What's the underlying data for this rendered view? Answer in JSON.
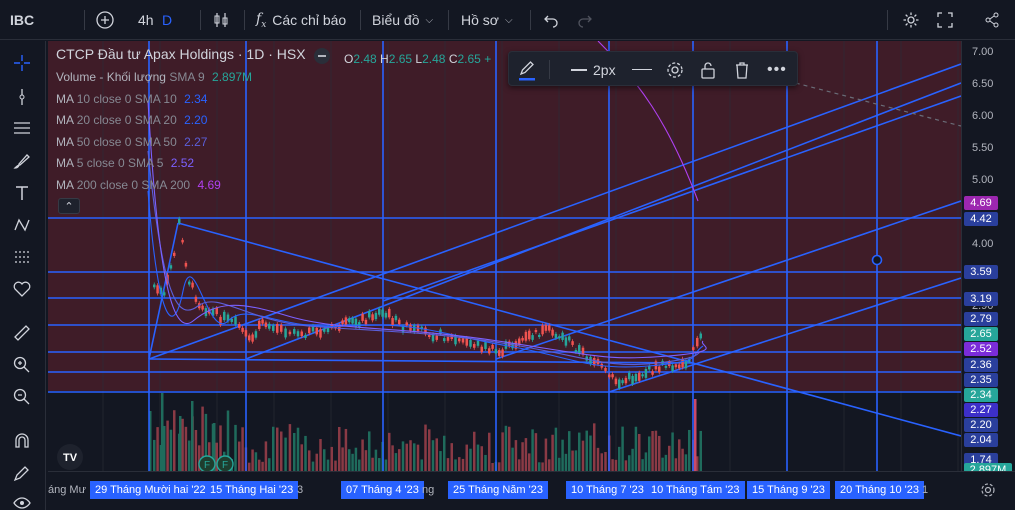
{
  "toolbar": {
    "symbol": "IBC",
    "interval": "4h",
    "interval_d": "D",
    "indicators": "Các chỉ báo",
    "chart_type": "Biểu đồ",
    "profile": "Hồ sơ"
  },
  "legend": {
    "title": "CTCP Đầu tư Apax Holdings · 1D · HSX",
    "ohlc": {
      "o_label": "O",
      "o": "2.48",
      "h_label": "H",
      "h": "2.65",
      "l_label": "L",
      "l": "2.48",
      "c_label": "C",
      "c": "2.65",
      "plus": "+"
    },
    "rows": [
      {
        "label": "Volume - Khối lượng",
        "params": "SMA 9",
        "value": "2.897M",
        "color": "#26a69a"
      },
      {
        "label": "MA",
        "params": "10 close 0 SMA 10",
        "value": "2.34",
        "color": "#2962ff"
      },
      {
        "label": "MA",
        "params": "20 close 0 SMA 20",
        "value": "2.20",
        "color": "#2962ff"
      },
      {
        "label": "MA",
        "params": "50 close 0 SMA 50",
        "value": "2.27",
        "color": "#5b5fd9"
      },
      {
        "label": "MA",
        "params": "5 close 0 SMA 5",
        "value": "2.52",
        "color": "#7b61ff"
      },
      {
        "label": "MA",
        "params": "200 close 0 SMA 200",
        "value": "4.69",
        "color": "#b040f0"
      }
    ],
    "collapse": "⌃"
  },
  "drawbar": {
    "width_label": "2px"
  },
  "price_axis": {
    "ticks": [
      "7.00",
      "6.50",
      "6.00",
      "5.50",
      "5.00",
      "4.00",
      "2.90"
    ],
    "tags": [
      {
        "value": "4.69",
        "color": "#9c27b0"
      },
      {
        "value": "4.42",
        "color": "#2a3f9c"
      },
      {
        "value": "3.59",
        "color": "#2a3f9c"
      },
      {
        "value": "3.19",
        "color": "#2a3f9c"
      },
      {
        "value": "2.79",
        "color": "#2a3f9c"
      },
      {
        "value": "2.65",
        "color": "#26a69a"
      },
      {
        "value": "2.52",
        "color": "#7b2cd9"
      },
      {
        "value": "2.36",
        "color": "#2a3f9c"
      },
      {
        "value": "2.35",
        "color": "#2a3f9c"
      },
      {
        "value": "2.34",
        "color": "#26a69a"
      },
      {
        "value": "2.27",
        "color": "#3d2fc9"
      },
      {
        "value": "2.20",
        "color": "#2a3f9c"
      },
      {
        "value": "2.04",
        "color": "#2a3f9c"
      },
      {
        "value": "1.74",
        "color": "#2a3f9c"
      },
      {
        "value": "2.897M",
        "color": "#26a69a"
      }
    ]
  },
  "time_axis": {
    "left_fragment": "áng Mư",
    "tags": [
      "29 Tháng Mười hai '22",
      "15 Tháng Hai '23",
      "07 Tháng 4 '23",
      "25 Tháng Năm '23",
      "10 Tháng 7 '23",
      "10 Tháng Tám '23",
      "15 Tháng 9 '23",
      "20 Tháng 10 '23"
    ],
    "fragments": [
      "3",
      "ng",
      "1"
    ]
  },
  "markers": {
    "f1": "F",
    "f2": "F"
  },
  "logo": "TV",
  "colors": {
    "background": "#131722",
    "drawing": "#2962ff",
    "up": "#26a69a",
    "down": "#ef5350",
    "shaded": "#4a1f2b"
  }
}
